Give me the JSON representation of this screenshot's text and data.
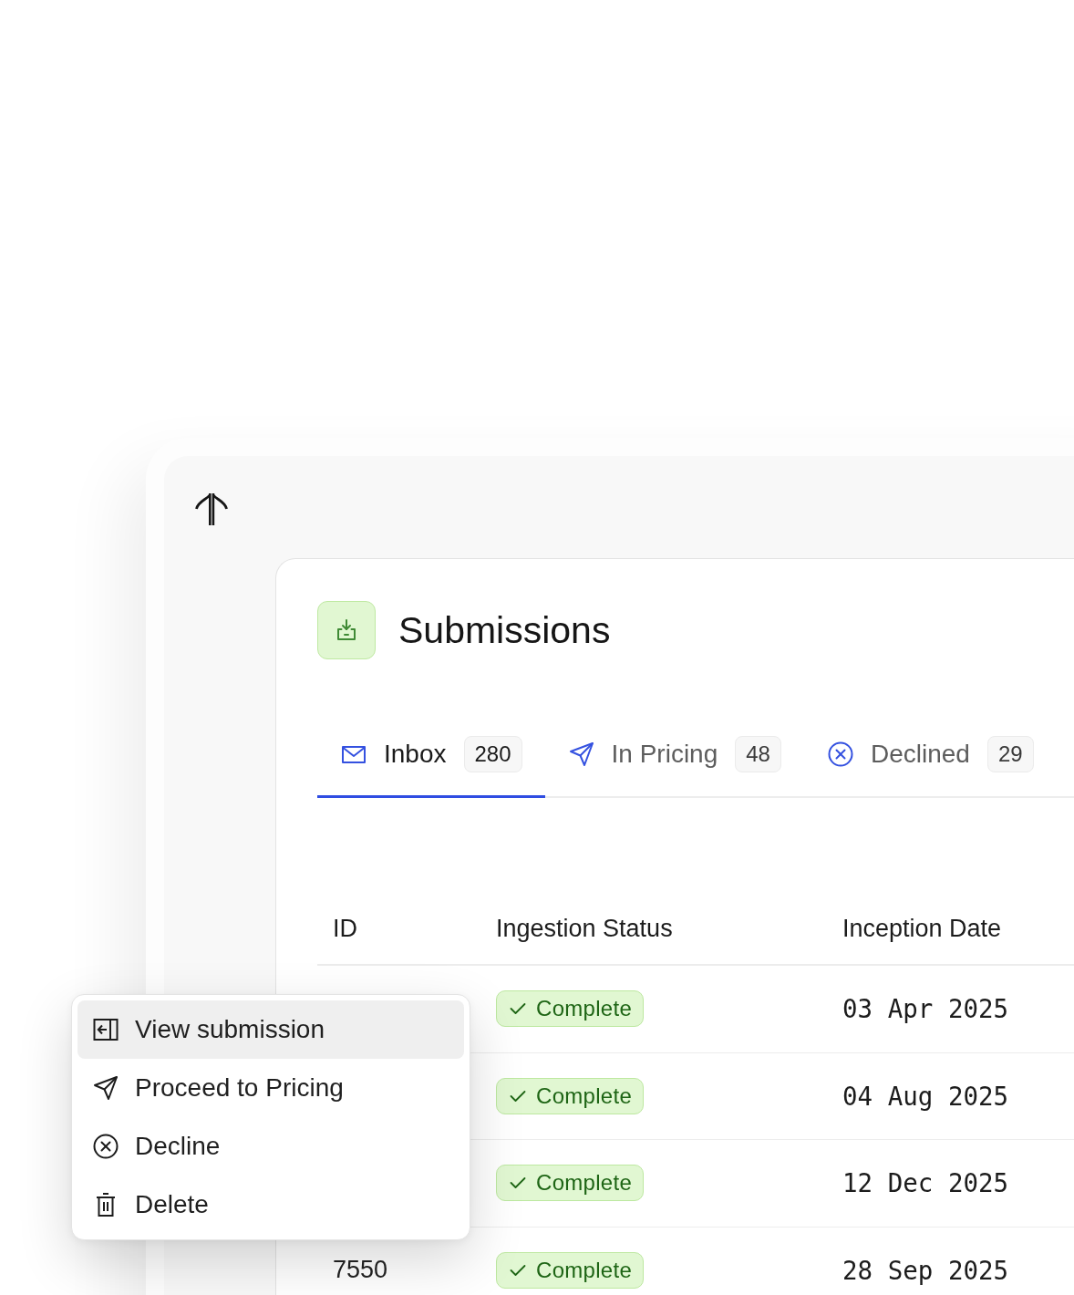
{
  "page": {
    "title": "Submissions"
  },
  "tabs": [
    {
      "label": "Inbox",
      "count": "280",
      "selected": true
    },
    {
      "label": "In Pricing",
      "count": "48",
      "selected": false
    },
    {
      "label": "Declined",
      "count": "29",
      "selected": false
    }
  ],
  "table": {
    "columns": [
      "ID",
      "Ingestion Status",
      "Inception Date"
    ],
    "rows": [
      {
        "status": "Complete",
        "date": "03 Apr 2025"
      },
      {
        "status": "Complete",
        "date": "04 Aug 2025"
      },
      {
        "status": "Complete",
        "date": "12 Dec 2025"
      },
      {
        "id": "7550",
        "status": "Complete",
        "date": "28 Sep 2025"
      }
    ]
  },
  "context_menu": {
    "items": [
      {
        "label": "View submission",
        "selected": true
      },
      {
        "label": "Proceed to Pricing",
        "selected": false
      },
      {
        "label": "Decline",
        "selected": false
      },
      {
        "label": "Delete",
        "selected": false
      }
    ]
  }
}
